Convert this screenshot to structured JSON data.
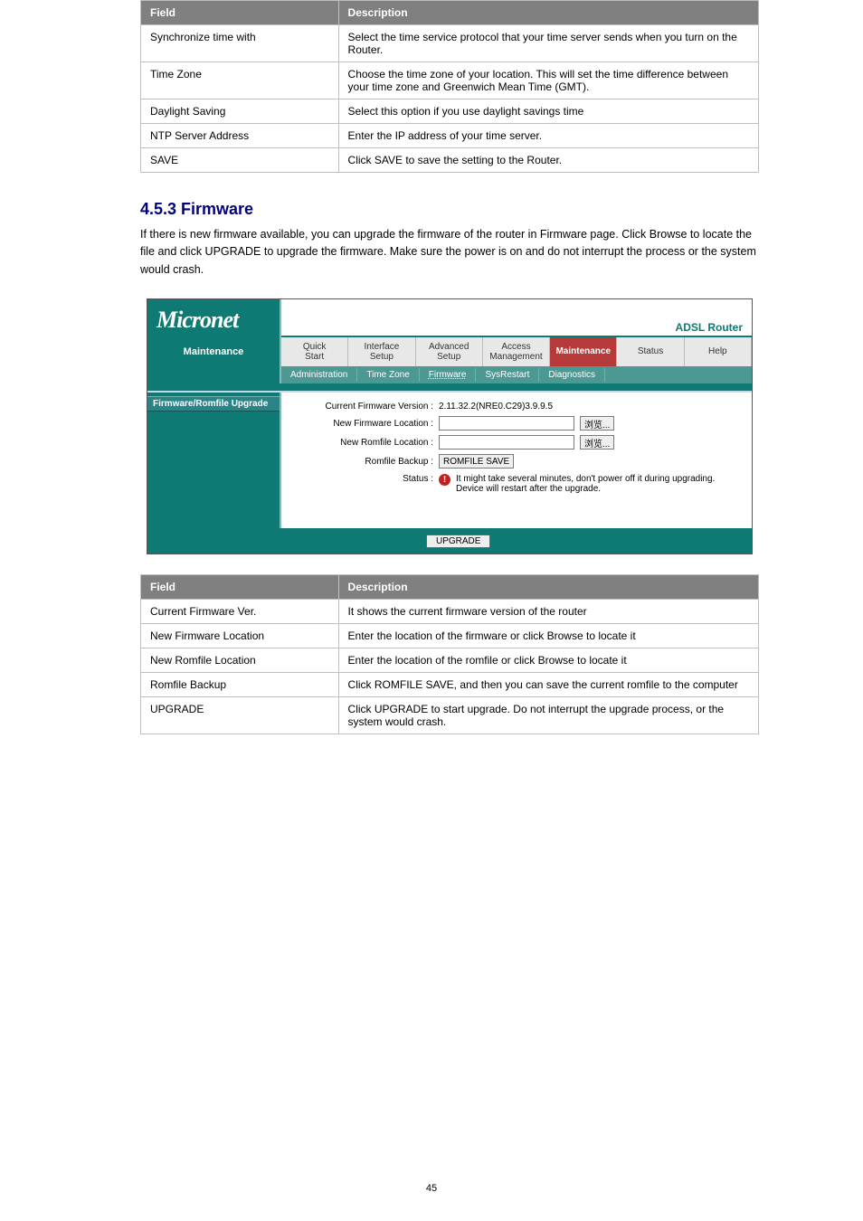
{
  "page_number": "45",
  "table1": {
    "header_field": "Field",
    "header_desc": "Description",
    "rows": [
      {
        "field": "Synchronize time with",
        "desc": "Select the time service protocol that your time server sends when you turn on the Router."
      },
      {
        "field": "Time Zone",
        "desc": "Choose the time zone of your location. This will set the time difference between your time zone and Greenwich Mean Time (GMT)."
      },
      {
        "field": "Daylight Saving",
        "desc": "Select this option if you use daylight savings time"
      },
      {
        "field": "NTP Server Address",
        "desc": "Enter the IP address of your time server."
      },
      {
        "field": "SAVE",
        "desc": "Click SAVE to save the setting to the Router."
      }
    ]
  },
  "section": {
    "title": "4.5.3 Firmware",
    "para": "If there is new firmware available, you can upgrade the firmware of the router in Firmware page. Click Browse to locate the file and click UPGRADE to upgrade the firmware. Make sure the power is on and do not interrupt the process or the system would crash."
  },
  "shot": {
    "logo": "Micronet",
    "brand": "ADSL Router",
    "side_label": "Maintenance",
    "tabs": [
      "Quick\nStart",
      "Interface\nSetup",
      "Advanced\nSetup",
      "Access\nManagement",
      "Maintenance",
      "Status",
      "Help"
    ],
    "active_tab_index": 4,
    "subtabs": [
      "Administration",
      "Time Zone",
      "Firmware",
      "SysRestart",
      "Diagnostics"
    ],
    "active_subtab_index": 2,
    "side_section": "Firmware/Romfile Upgrade",
    "rows": {
      "current_fw_label": "Current Firmware Version :",
      "current_fw_value": "2.11.32.2(NRE0.C29)3.9.9.5",
      "new_fw_label": "New Firmware Location :",
      "new_rom_label": "New Romfile Location :",
      "rom_backup_label": "Romfile Backup :",
      "romfile_save_btn": "ROMFILE SAVE",
      "browse_btn": "浏览...",
      "status_label": "Status :",
      "status_msg": "It might take several minutes, don't power off it during upgrading. Device will restart after the upgrade."
    },
    "upgrade_btn": "UPGRADE"
  },
  "table2": {
    "header_field": "Field",
    "header_desc": "Description",
    "rows": [
      {
        "field": "Current Firmware Ver.",
        "desc": "It shows the current firmware version of the router"
      },
      {
        "field": "New Firmware Location",
        "desc": "Enter the location of the firmware or click Browse to locate it"
      },
      {
        "field": "New Romfile Location",
        "desc": "Enter the location of the romfile or click Browse to locate it"
      },
      {
        "field": "Romfile Backup",
        "desc": "Click ROMFILE SAVE, and then you can save the current romfile to the computer"
      },
      {
        "field": "UPGRADE",
        "desc": "Click UPGRADE to start upgrade. Do not interrupt the upgrade process, or the system would crash."
      }
    ]
  }
}
